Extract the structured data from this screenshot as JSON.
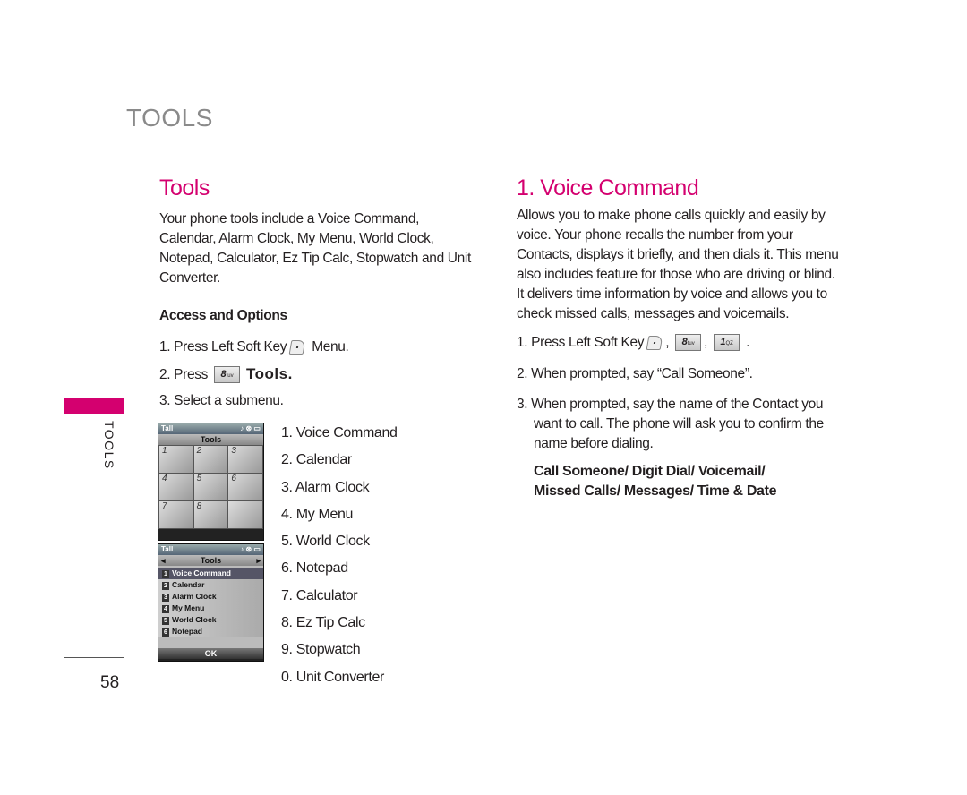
{
  "header": {
    "section_title": "TOOLS"
  },
  "side_tab": {
    "label": "TOOLS",
    "accent_color": "#d4006f"
  },
  "page_number": "58",
  "left": {
    "title": "Tools",
    "intro_lines": [
      "Your phone tools include a Voice Command,",
      "Calendar, Alarm Clock, My Menu, World Clock,",
      "Notepad, Calculator, Ez Tip Calc, Stopwatch and Unit",
      "Converter."
    ],
    "access_heading": "Access and Options",
    "steps": [
      {
        "text": "1. Press Left Soft Key",
        "icon": "left-soft-key-icon",
        "suffix": "Menu."
      },
      {
        "text": "2. Press",
        "key": "8",
        "key_sub": "tuv",
        "suffix": "Tools."
      },
      {
        "text": "3. Select a submenu."
      }
    ],
    "submenu": [
      "1. Voice Command",
      "2. Calendar",
      "3. Alarm Clock",
      "4. My Menu",
      "5. World Clock",
      "6. Notepad",
      "7. Calculator",
      "8. Ez Tip Calc",
      "9. Stopwatch",
      "0. Unit Converter"
    ],
    "phone1": {
      "title": "Tools",
      "cells": [
        "1",
        "2",
        "3",
        "4",
        "5",
        "6",
        "7",
        "8",
        ""
      ]
    },
    "phone2": {
      "title": "Tools",
      "items": [
        "Voice Command",
        "Calendar",
        "Alarm Clock",
        "My Menu",
        "World Clock",
        "Notepad"
      ],
      "ok": "OK"
    }
  },
  "right": {
    "title": "1. Voice Command",
    "intro_lines": [
      "Allows you to make phone calls quickly and easily by",
      "voice. Your phone recalls the number from your",
      "Contacts, displays it briefly, and then dials it. This menu",
      "also includes feature for those who are driving or blind.",
      "It delivers time information by voice and allows you to",
      "check  missed calls, messages and voicemails."
    ],
    "step1": {
      "text": "1. Press Left Soft Key",
      "key1": "8",
      "key1_sub": "tuv",
      "key2": "1",
      "key2_sub": "QZ",
      "sep": ",",
      "end": "."
    },
    "step2": "2. When prompted, say “Call Someone”.",
    "step3_lines": [
      "3. When prompted, say the name of the Contact you",
      "want to call. The phone will ask you to confirm the",
      "name before dialing."
    ],
    "options_lines": [
      "Call Someone/ Digit Dial/ Voicemail/",
      "Missed Calls/ Messages/ Time & Date"
    ]
  }
}
